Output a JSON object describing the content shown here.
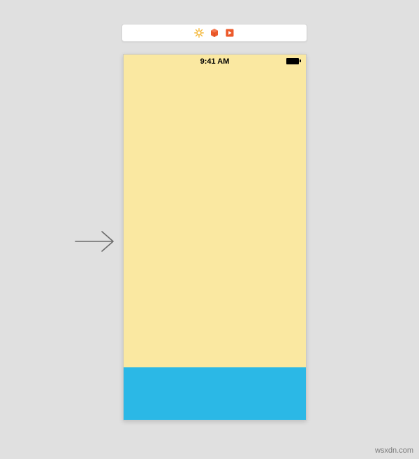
{
  "toolbar": {
    "icons": {
      "sun": "sun-icon",
      "cube": "cube-icon",
      "preview": "preview-icon"
    },
    "colors": {
      "sun": "#f4b93c",
      "cube": "#ec5a2b",
      "preview": "#ec5a2b"
    }
  },
  "device": {
    "status": {
      "time": "9:41 AM"
    },
    "colors": {
      "background": "#fae8a1",
      "panel": "#2bb8e6"
    }
  },
  "watermark": {
    "text": "wsxdn.com"
  }
}
